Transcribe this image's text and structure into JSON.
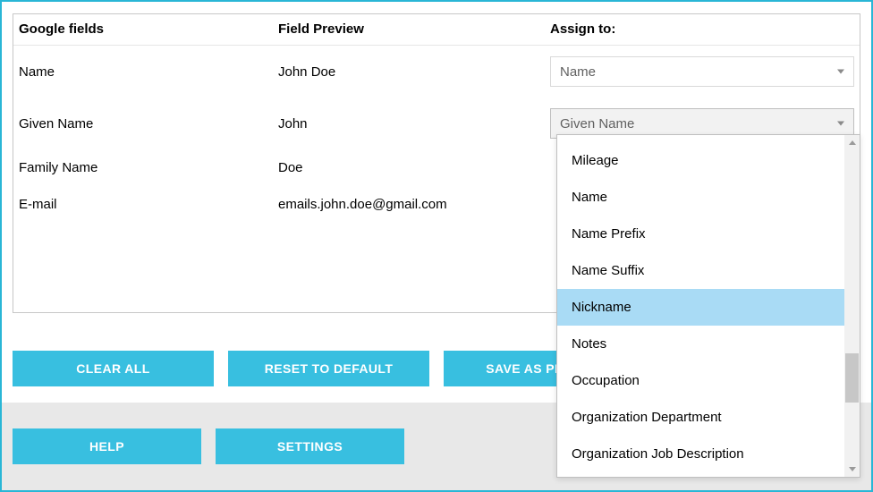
{
  "headers": {
    "google": "Google fields",
    "preview": "Field Preview",
    "assign": "Assign to:"
  },
  "rows": [
    {
      "google": "Name",
      "preview": "John Doe",
      "assign": "Name",
      "active": false
    },
    {
      "google": "Given Name",
      "preview": "John",
      "assign": "Given Name",
      "active": true
    },
    {
      "google": "Family Name",
      "preview": "Doe",
      "assign": "",
      "active": false
    },
    {
      "google": "E-mail",
      "preview": "emails.john.doe@gmail.com",
      "assign": "",
      "active": false
    }
  ],
  "buttons": {
    "clear_all": "CLEAR ALL",
    "reset": "RESET TO DEFAULT",
    "save_profile": "SAVE AS PROFILE",
    "help": "HELP",
    "settings": "SETTINGS"
  },
  "dropdown": {
    "items": [
      {
        "label": "Mileage",
        "highlighted": false
      },
      {
        "label": "Name",
        "highlighted": false
      },
      {
        "label": "Name Prefix",
        "highlighted": false
      },
      {
        "label": "Name Suffix",
        "highlighted": false
      },
      {
        "label": "Nickname",
        "highlighted": true
      },
      {
        "label": "Notes",
        "highlighted": false
      },
      {
        "label": "Occupation",
        "highlighted": false
      },
      {
        "label": "Organization Department",
        "highlighted": false
      },
      {
        "label": "Organization Job Description",
        "highlighted": false
      }
    ]
  }
}
